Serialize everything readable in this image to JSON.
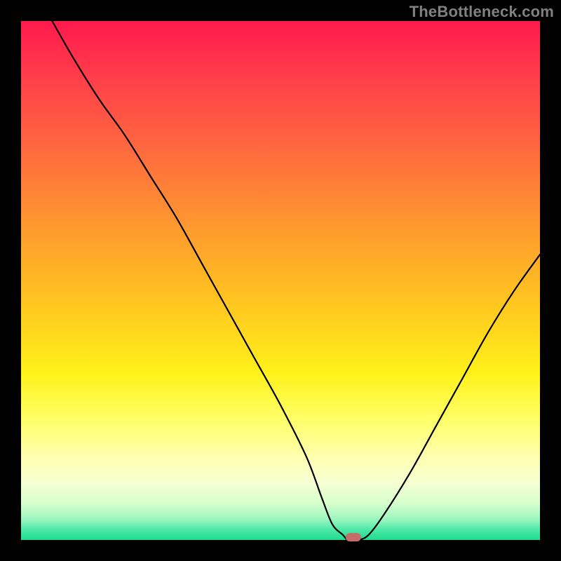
{
  "watermark": "TheBottleneck.com",
  "chart_data": {
    "type": "line",
    "title": "",
    "xlabel": "",
    "ylabel": "",
    "xlim": [
      0,
      100
    ],
    "ylim": [
      0,
      100
    ],
    "series": [
      {
        "name": "curve",
        "x": [
          6,
          10,
          15,
          20,
          25,
          30,
          35,
          40,
          45,
          50,
          55,
          58,
          60,
          62,
          63,
          65,
          67,
          70,
          75,
          80,
          85,
          90,
          95,
          100
        ],
        "y": [
          100,
          93,
          85,
          78,
          70,
          62,
          53,
          44,
          35,
          26,
          16,
          8,
          3,
          1,
          0,
          0,
          1,
          5,
          13,
          22,
          31,
          40,
          48,
          55
        ]
      }
    ],
    "marker": {
      "x": 64,
      "y": 0.5,
      "color": "#c76b6b",
      "width_pct": 3.0,
      "height_pct": 1.6
    },
    "background": "vertical-gradient red→yellow→green"
  }
}
